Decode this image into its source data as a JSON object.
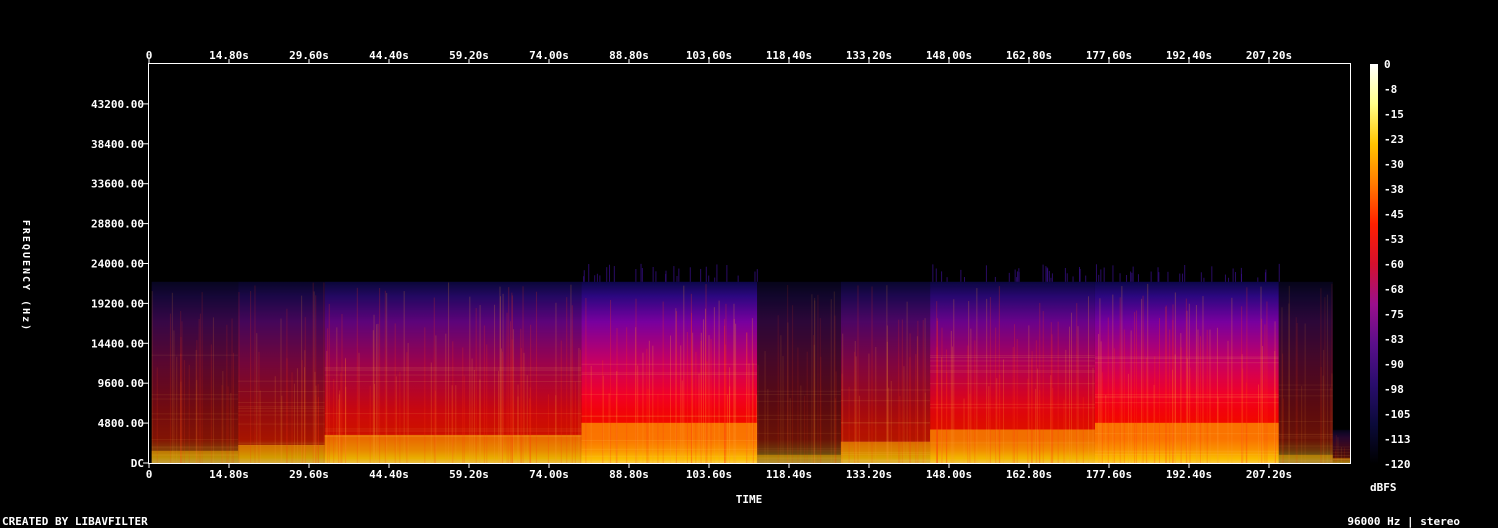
{
  "chart_data": {
    "type": "heatmap",
    "kind": "spectrogram",
    "xlabel": "TIME",
    "ylabel": "FREQUENCY (Hz)",
    "colorbar_label": "dBFS",
    "footer_left": "CREATED BY LIBAVFILTER",
    "footer_right": "96000 Hz | stereo",
    "sample_rate_hz": 96000,
    "channels": "stereo",
    "x_unit": "s",
    "x_range": [
      0,
      226
    ],
    "y_range": [
      0,
      48000
    ],
    "x_ticks": [
      "0",
      "14.80s",
      "29.60s",
      "44.40s",
      "59.20s",
      "74.00s",
      "88.80s",
      "103.60s",
      "118.40s",
      "133.20s",
      "148.00s",
      "162.80s",
      "177.60s",
      "192.40s",
      "207.20s"
    ],
    "x_tick_values": [
      0,
      14.8,
      29.6,
      44.4,
      59.2,
      74.0,
      88.8,
      103.6,
      118.4,
      133.2,
      148.0,
      162.8,
      177.6,
      192.4,
      207.2
    ],
    "y_ticks": [
      "DC",
      "4800.00",
      "9600.00",
      "14400.00",
      "19200.00",
      "24000.00",
      "28800.00",
      "33600.00",
      "38400.00",
      "43200.00"
    ],
    "y_tick_values": [
      0,
      4800,
      9600,
      14400,
      19200,
      24000,
      28800,
      33600,
      38400,
      43200
    ],
    "colorbar_ticks": [
      "0",
      "-8",
      "-15",
      "-23",
      "-30",
      "-38",
      "-45",
      "-53",
      "-60",
      "-68",
      "-75",
      "-83",
      "-90",
      "-98",
      "-105",
      "-113",
      "-120"
    ],
    "colorbar_range_db": [
      -120,
      0
    ],
    "colormap": [
      "#000000",
      "#0b0a3a",
      "#2a0d6e",
      "#5a0f8a",
      "#9a0f8c",
      "#d4102e",
      "#ff2000",
      "#ff7a00",
      "#ffc400",
      "#ffff88",
      "#ffffff"
    ],
    "segments": [
      {
        "start": 0.5,
        "end": 16.5,
        "top_hz": 21800,
        "level": 0.3
      },
      {
        "start": 16.5,
        "end": 32.5,
        "top_hz": 21800,
        "level": 0.4
      },
      {
        "start": 32.5,
        "end": 80.0,
        "top_hz": 21800,
        "level": 0.55
      },
      {
        "start": 80.0,
        "end": 112.5,
        "top_hz": 21800,
        "level": 0.7
      },
      {
        "start": 112.5,
        "end": 128.0,
        "top_hz": 21800,
        "level": 0.22
      },
      {
        "start": 128.0,
        "end": 144.5,
        "top_hz": 21800,
        "level": 0.45
      },
      {
        "start": 144.5,
        "end": 175.0,
        "top_hz": 21800,
        "level": 0.62
      },
      {
        "start": 175.0,
        "end": 209.0,
        "top_hz": 21800,
        "level": 0.7
      },
      {
        "start": 209.0,
        "end": 219.0,
        "top_hz": 21800,
        "level": 0.22
      },
      {
        "start": 219.0,
        "end": 222.5,
        "top_hz": 4000,
        "level": 0.15
      }
    ]
  }
}
